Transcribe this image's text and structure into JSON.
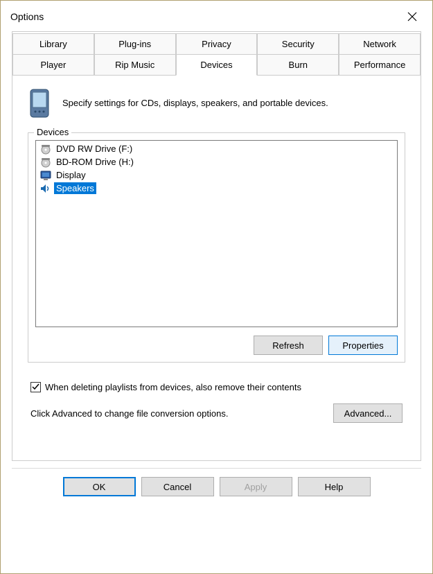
{
  "window": {
    "title": "Options"
  },
  "tabs": {
    "row1": [
      "Library",
      "Plug-ins",
      "Privacy",
      "Security",
      "Network"
    ],
    "row2": [
      "Player",
      "Rip Music",
      "Devices",
      "Burn",
      "Performance"
    ]
  },
  "panel": {
    "description": "Specify settings for CDs, displays, speakers, and portable devices.",
    "fieldset_label": "Devices",
    "devices": [
      {
        "name": "DVD RW Drive (F:)",
        "icon": "disc"
      },
      {
        "name": "BD-ROM Drive (H:)",
        "icon": "disc"
      },
      {
        "name": "Display",
        "icon": "monitor"
      },
      {
        "name": "Speakers",
        "icon": "speaker",
        "selected": true
      }
    ],
    "refresh_label": "Refresh",
    "properties_label": "Properties",
    "checkbox_label": "When deleting playlists from devices, also remove their contents",
    "checkbox_checked": true,
    "advanced_text": "Click Advanced to change file conversion options.",
    "advanced_label": "Advanced..."
  },
  "dialog": {
    "ok": "OK",
    "cancel": "Cancel",
    "apply": "Apply",
    "help": "Help"
  }
}
